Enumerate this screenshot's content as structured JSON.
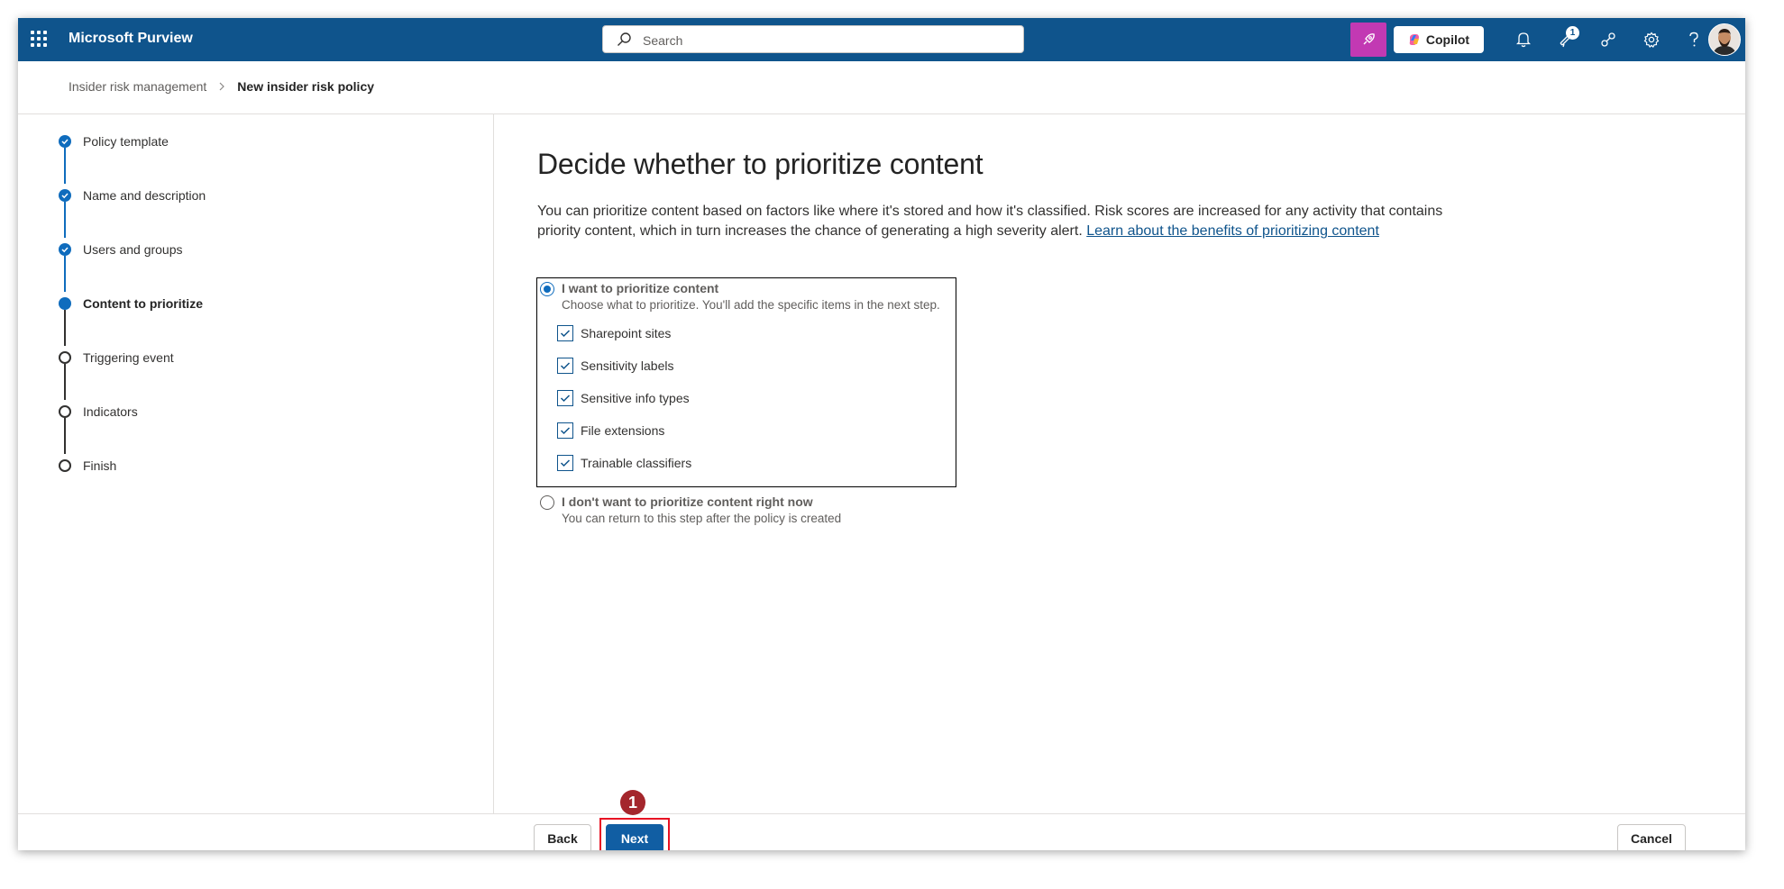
{
  "header": {
    "app_name": "Microsoft Purview",
    "search_placeholder": "Search",
    "copilot_label": "Copilot",
    "notification_badge": "1"
  },
  "breadcrumb": {
    "parent": "Insider risk management",
    "current": "New insider risk policy"
  },
  "steps": [
    {
      "label": "Policy template",
      "status": "completed"
    },
    {
      "label": "Name and description",
      "status": "completed"
    },
    {
      "label": "Users and groups",
      "status": "completed"
    },
    {
      "label": "Content to prioritize",
      "status": "current"
    },
    {
      "label": "Triggering event",
      "status": "not-started"
    },
    {
      "label": "Indicators",
      "status": "not-started"
    },
    {
      "label": "Finish",
      "status": "not-started"
    }
  ],
  "main": {
    "title": "Decide whether to prioritize content",
    "description": "You can prioritize content based on factors like where it's stored and how it's classified. Risk scores are increased for any activity that contains priority content, which in turn increases the chance of generating a high severity alert.",
    "learn_link": "Learn about the benefits of prioritizing content",
    "option_yes": {
      "label": "I want to prioritize content",
      "sub": "Choose what to prioritize. You'll add the specific items in the next step.",
      "selected": true,
      "checkboxes": [
        {
          "label": "Sharepoint sites",
          "checked": true
        },
        {
          "label": "Sensitivity labels",
          "checked": true
        },
        {
          "label": "Sensitive info types",
          "checked": true
        },
        {
          "label": "File extensions",
          "checked": true
        },
        {
          "label": "Trainable classifiers",
          "checked": true
        }
      ]
    },
    "option_no": {
      "label": "I don't want to prioritize content right now",
      "sub": "You can return to this step after the policy is created",
      "selected": false
    }
  },
  "footer": {
    "back_label": "Back",
    "next_label": "Next",
    "cancel_label": "Cancel"
  },
  "annotation": {
    "callout_number": "1",
    "highlight_color": "#e81123"
  },
  "colors": {
    "header_bg": "#0f548c",
    "accent": "#0f6cbd",
    "primary_button": "#115ea3",
    "copilot_pink": "#c239b3"
  }
}
